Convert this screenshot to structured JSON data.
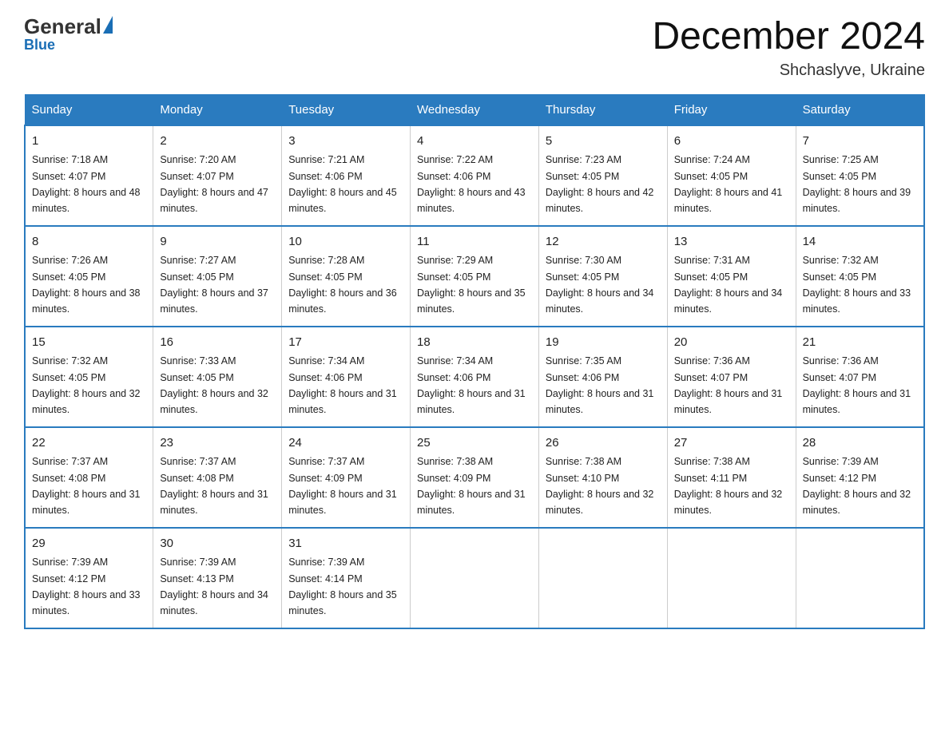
{
  "logo": {
    "general": "General",
    "blue": "Blue",
    "subtitle": "Blue"
  },
  "title": {
    "month": "December 2024",
    "location": "Shchaslyve, Ukraine"
  },
  "weekdays": [
    "Sunday",
    "Monday",
    "Tuesday",
    "Wednesday",
    "Thursday",
    "Friday",
    "Saturday"
  ],
  "weeks": [
    [
      {
        "day": "1",
        "sunrise": "7:18 AM",
        "sunset": "4:07 PM",
        "daylight": "8 hours and 48 minutes."
      },
      {
        "day": "2",
        "sunrise": "7:20 AM",
        "sunset": "4:07 PM",
        "daylight": "8 hours and 47 minutes."
      },
      {
        "day": "3",
        "sunrise": "7:21 AM",
        "sunset": "4:06 PM",
        "daylight": "8 hours and 45 minutes."
      },
      {
        "day": "4",
        "sunrise": "7:22 AM",
        "sunset": "4:06 PM",
        "daylight": "8 hours and 43 minutes."
      },
      {
        "day": "5",
        "sunrise": "7:23 AM",
        "sunset": "4:05 PM",
        "daylight": "8 hours and 42 minutes."
      },
      {
        "day": "6",
        "sunrise": "7:24 AM",
        "sunset": "4:05 PM",
        "daylight": "8 hours and 41 minutes."
      },
      {
        "day": "7",
        "sunrise": "7:25 AM",
        "sunset": "4:05 PM",
        "daylight": "8 hours and 39 minutes."
      }
    ],
    [
      {
        "day": "8",
        "sunrise": "7:26 AM",
        "sunset": "4:05 PM",
        "daylight": "8 hours and 38 minutes."
      },
      {
        "day": "9",
        "sunrise": "7:27 AM",
        "sunset": "4:05 PM",
        "daylight": "8 hours and 37 minutes."
      },
      {
        "day": "10",
        "sunrise": "7:28 AM",
        "sunset": "4:05 PM",
        "daylight": "8 hours and 36 minutes."
      },
      {
        "day": "11",
        "sunrise": "7:29 AM",
        "sunset": "4:05 PM",
        "daylight": "8 hours and 35 minutes."
      },
      {
        "day": "12",
        "sunrise": "7:30 AM",
        "sunset": "4:05 PM",
        "daylight": "8 hours and 34 minutes."
      },
      {
        "day": "13",
        "sunrise": "7:31 AM",
        "sunset": "4:05 PM",
        "daylight": "8 hours and 34 minutes."
      },
      {
        "day": "14",
        "sunrise": "7:32 AM",
        "sunset": "4:05 PM",
        "daylight": "8 hours and 33 minutes."
      }
    ],
    [
      {
        "day": "15",
        "sunrise": "7:32 AM",
        "sunset": "4:05 PM",
        "daylight": "8 hours and 32 minutes."
      },
      {
        "day": "16",
        "sunrise": "7:33 AM",
        "sunset": "4:05 PM",
        "daylight": "8 hours and 32 minutes."
      },
      {
        "day": "17",
        "sunrise": "7:34 AM",
        "sunset": "4:06 PM",
        "daylight": "8 hours and 31 minutes."
      },
      {
        "day": "18",
        "sunrise": "7:34 AM",
        "sunset": "4:06 PM",
        "daylight": "8 hours and 31 minutes."
      },
      {
        "day": "19",
        "sunrise": "7:35 AM",
        "sunset": "4:06 PM",
        "daylight": "8 hours and 31 minutes."
      },
      {
        "day": "20",
        "sunrise": "7:36 AM",
        "sunset": "4:07 PM",
        "daylight": "8 hours and 31 minutes."
      },
      {
        "day": "21",
        "sunrise": "7:36 AM",
        "sunset": "4:07 PM",
        "daylight": "8 hours and 31 minutes."
      }
    ],
    [
      {
        "day": "22",
        "sunrise": "7:37 AM",
        "sunset": "4:08 PM",
        "daylight": "8 hours and 31 minutes."
      },
      {
        "day": "23",
        "sunrise": "7:37 AM",
        "sunset": "4:08 PM",
        "daylight": "8 hours and 31 minutes."
      },
      {
        "day": "24",
        "sunrise": "7:37 AM",
        "sunset": "4:09 PM",
        "daylight": "8 hours and 31 minutes."
      },
      {
        "day": "25",
        "sunrise": "7:38 AM",
        "sunset": "4:09 PM",
        "daylight": "8 hours and 31 minutes."
      },
      {
        "day": "26",
        "sunrise": "7:38 AM",
        "sunset": "4:10 PM",
        "daylight": "8 hours and 32 minutes."
      },
      {
        "day": "27",
        "sunrise": "7:38 AM",
        "sunset": "4:11 PM",
        "daylight": "8 hours and 32 minutes."
      },
      {
        "day": "28",
        "sunrise": "7:39 AM",
        "sunset": "4:12 PM",
        "daylight": "8 hours and 32 minutes."
      }
    ],
    [
      {
        "day": "29",
        "sunrise": "7:39 AM",
        "sunset": "4:12 PM",
        "daylight": "8 hours and 33 minutes."
      },
      {
        "day": "30",
        "sunrise": "7:39 AM",
        "sunset": "4:13 PM",
        "daylight": "8 hours and 34 minutes."
      },
      {
        "day": "31",
        "sunrise": "7:39 AM",
        "sunset": "4:14 PM",
        "daylight": "8 hours and 35 minutes."
      },
      null,
      null,
      null,
      null
    ]
  ]
}
